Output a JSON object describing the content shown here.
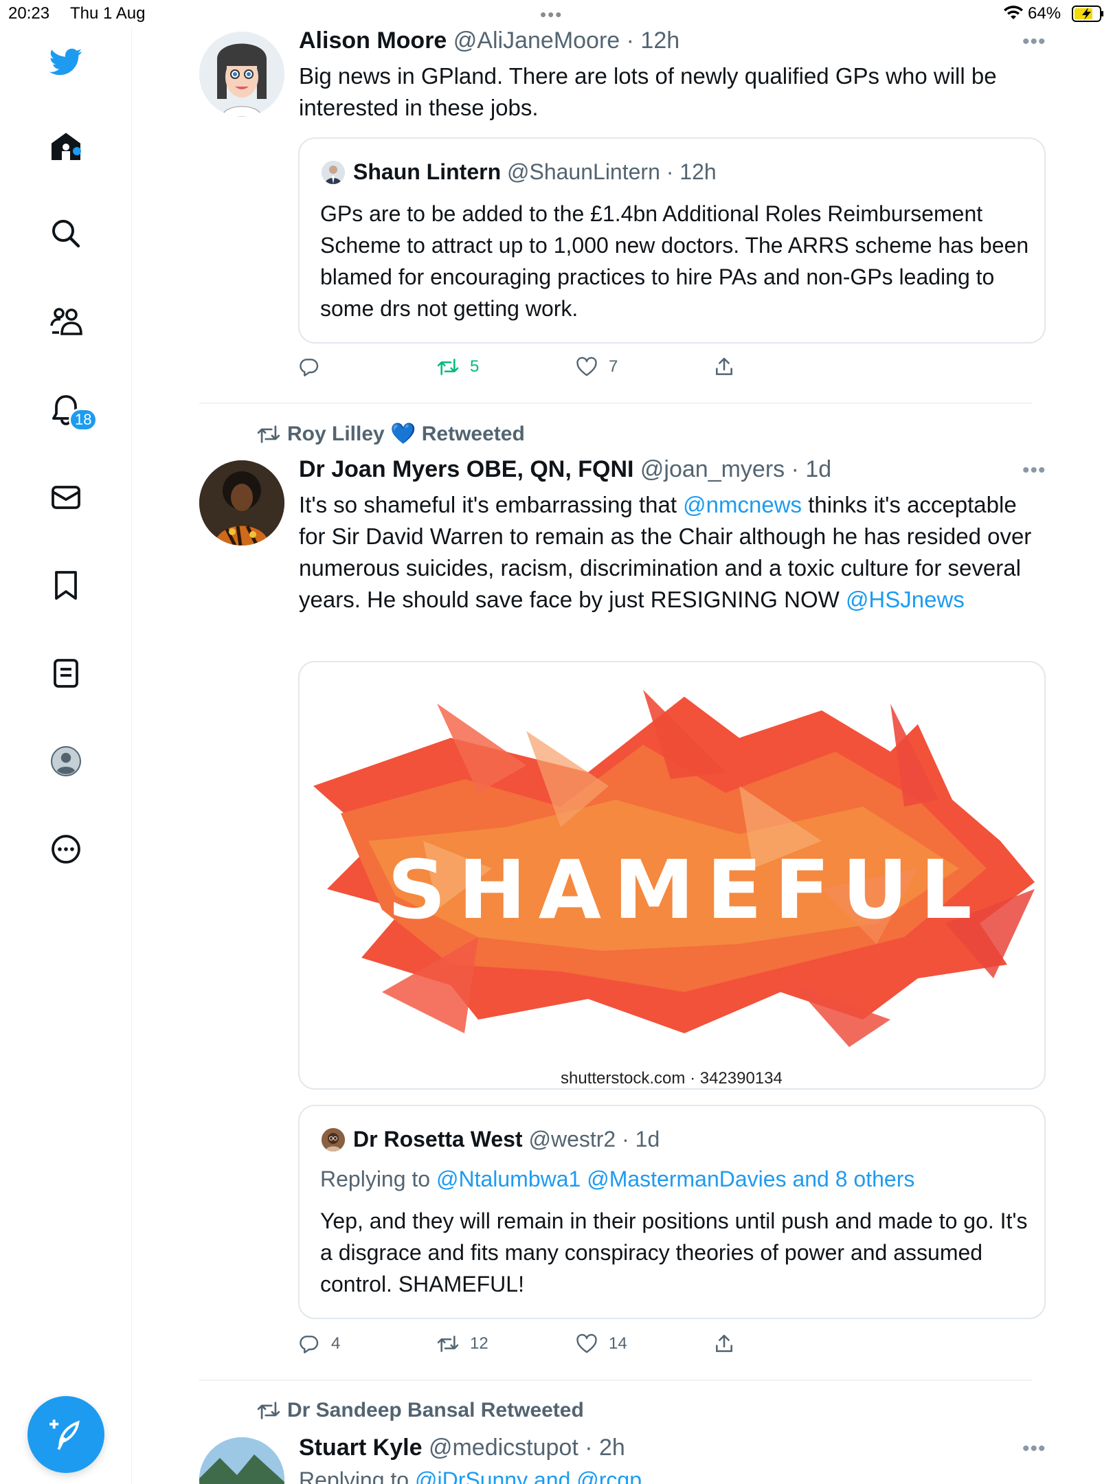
{
  "status_bar": {
    "time": "20:23",
    "date": "Thu 1 Aug",
    "dots": "•••",
    "battery": "64%"
  },
  "sidebar": {
    "notifications_badge": "18",
    "items": [
      "twitter-logo",
      "home",
      "search",
      "communities",
      "notifications",
      "messages",
      "bookmarks",
      "lists",
      "profile",
      "more"
    ]
  },
  "colors": {
    "accent": "#1d9bf0",
    "retweet_green": "#00ba7c",
    "secondary_text": "#536471"
  },
  "tweets": [
    {
      "name": "Alison Moore",
      "handle": "@AliJaneMoore",
      "time": "· 12h",
      "text": "Big news in GPland. There are lots of newly qualified GPs who will be interested in these jobs.",
      "quote": {
        "name": "Shaun Lintern",
        "handle": "@ShaunLintern",
        "time": "· 12h",
        "text": "GPs are to be added to the £1.4bn Additional Roles Reimbursement Scheme to attract up to 1,000 new doctors. The ARRS scheme has been blamed for encouraging practices to hire PAs and non-GPs leading to some drs not getting work."
      },
      "actions": {
        "replies": "",
        "retweets": "5",
        "likes": "7"
      }
    },
    {
      "retweeted_by": "Roy Lilley 💙 Retweeted",
      "name": "Dr Joan Myers OBE, QN, FQNI",
      "handle": "@joan_myers",
      "time": "· 1d",
      "text_parts": {
        "before": "It's so shameful it's embarrassing that ",
        "mention1": "@nmcnews",
        "middle": " thinks it's acceptable for Sir David Warren to remain as the Chair although he has resided over numerous suicides, racism, discrimination and a toxic culture for several years. He should save face by just RESIGNING NOW ",
        "mention2": "@HSJnews"
      },
      "media": {
        "image_text": "SHAMEFUL",
        "watermark": "shutterstock.com · 342390134"
      },
      "quote": {
        "name": "Dr Rosetta West",
        "handle": "@westr2",
        "time": "· 1d",
        "replying_prefix": "Replying to ",
        "replying_to": "@Ntalumbwa1 @MastermanDavies and 8 others",
        "text": "Yep, and they will remain in their positions until push and made to go. It's a disgrace and fits many conspiracy theories of power and assumed control. SHAMEFUL!"
      },
      "actions": {
        "replies": "4",
        "retweets": "12",
        "likes": "14"
      }
    },
    {
      "retweeted_by": "Dr Sandeep Bansal Retweeted",
      "name": "Stuart Kyle",
      "handle": "@medicstupot",
      "time": "· 2h",
      "replying_prefix": "Replying to ",
      "replying_to": "@iDrSunny and @rcgp"
    }
  ],
  "more_label": "•••"
}
